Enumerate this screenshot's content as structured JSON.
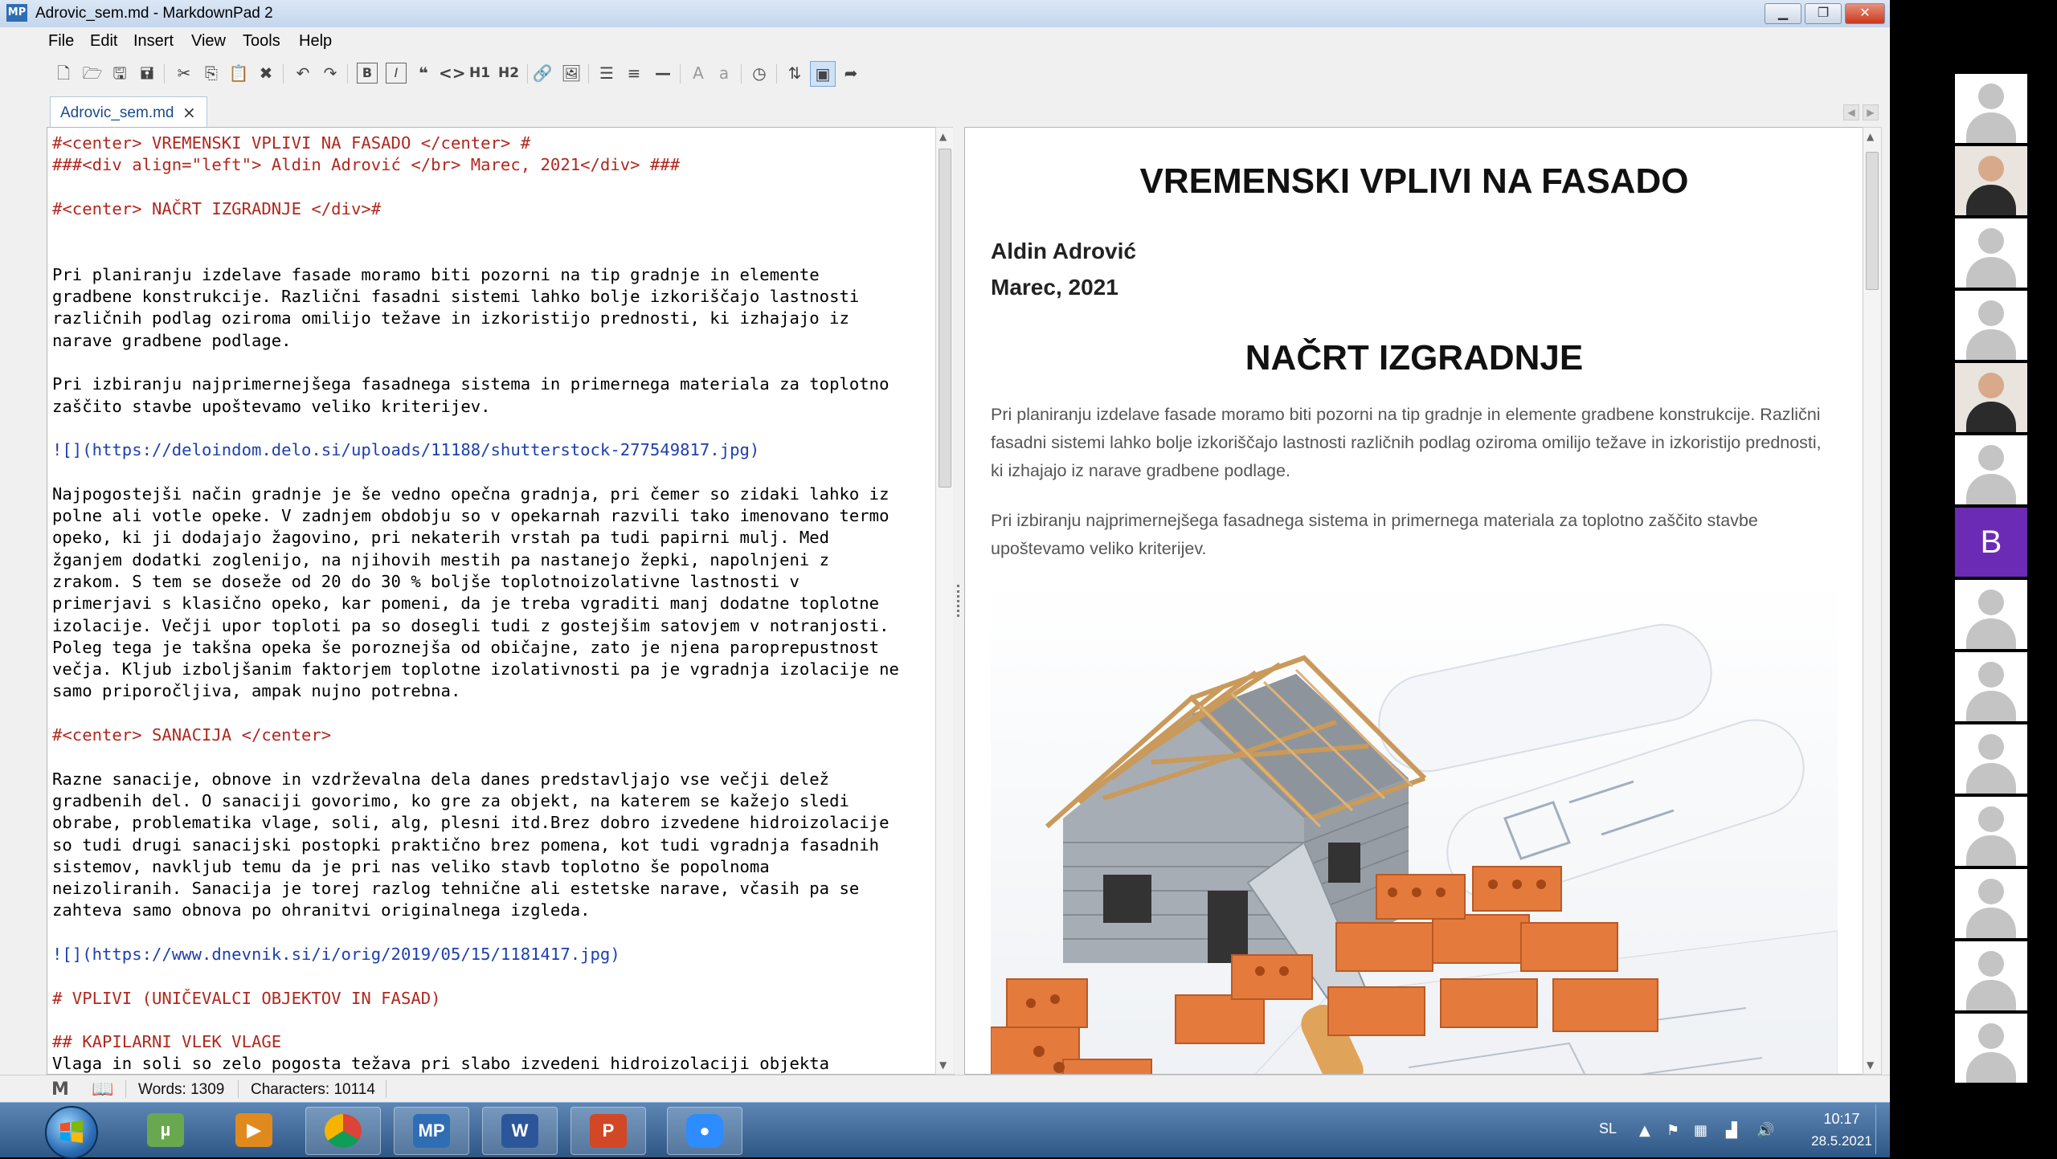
{
  "window": {
    "title": "Adrovic_sem.md - MarkdownPad 2",
    "logo": "MP",
    "minimize_icon": "minimize-icon",
    "maximize_icon": "restore-icon",
    "close_icon": "close-icon"
  },
  "menu": [
    "File",
    "Edit",
    "Insert",
    "View",
    "Tools",
    "Help"
  ],
  "toolbar": {
    "icons": [
      "new-file-icon",
      "open-folder-icon",
      "save-icon",
      "save-all-icon",
      "cut-icon",
      "copy-icon",
      "paste-icon",
      "delete-icon",
      "undo-icon",
      "redo-icon",
      "bold-icon",
      "italic-icon",
      "quote-icon",
      "code-icon",
      "h1-icon",
      "h2-icon",
      "link-icon",
      "image-icon",
      "bullet-list-icon",
      "numbered-list-icon",
      "horizontal-rule-icon",
      "uppercase-icon",
      "lowercase-icon",
      "timestamp-icon",
      "sync-scroll-icon",
      "live-preview-icon",
      "export-icon"
    ],
    "h1_label": "H1",
    "h2_label": "H2",
    "bold_label": "B",
    "italic_label": "I",
    "upper_label": "A",
    "lower_label": "a"
  },
  "tab": {
    "label": "Adrovic_sem.md",
    "close": "×"
  },
  "editor": {
    "lines": [
      {
        "text": "#<center> VREMENSKI VPLIVI NA FASADO </center> #",
        "kind": "hd"
      },
      {
        "text": "###<div align=\"left\"> Aldin Adrović </br> Marec, 2021</div> ###",
        "kind": "hd"
      },
      {
        "text": "",
        "kind": ""
      },
      {
        "text": "#<center> NAČRT IZGRADNJE </div>#",
        "kind": "hd"
      },
      {
        "text": "",
        "kind": ""
      },
      {
        "text": "",
        "kind": ""
      },
      {
        "text": "Pri planiranju izdelave fasade moramo biti pozorni na tip gradnje in elemente",
        "kind": ""
      },
      {
        "text": "gradbene konstrukcije. Različni fasadni sistemi lahko bolje izkoriščajo lastnosti",
        "kind": ""
      },
      {
        "text": "različnih podlag oziroma omilijo težave in izkoristijo prednosti, ki izhajajo iz",
        "kind": ""
      },
      {
        "text": "narave gradbene podlage.",
        "kind": ""
      },
      {
        "text": "",
        "kind": ""
      },
      {
        "text": "Pri izbiranju najprimernejšega fasadnega sistema in primernega materiala za toplotno",
        "kind": ""
      },
      {
        "text": "zaščito stavbe upoštevamo veliko kriterijev.",
        "kind": ""
      },
      {
        "text": "",
        "kind": ""
      },
      {
        "text": "![](https://deloindom.delo.si/uploads/11188/shutterstock-277549817.jpg)",
        "kind": "lk"
      },
      {
        "text": "",
        "kind": ""
      },
      {
        "text": "Najpogostejši način gradnje je še vedno opečna gradnja, pri čemer so zidaki lahko iz",
        "kind": ""
      },
      {
        "text": "polne ali votle opeke. V zadnjem obdobju so v opekarnah razvili tako imenovano termo",
        "kind": ""
      },
      {
        "text": "opeko, ki ji dodajajo žagovino, pri nekaterih vrstah pa tudi papirni mulj. Med",
        "kind": ""
      },
      {
        "text": "žganjem dodatki zoglenijo, na njihovih mestih pa nastanejo žepki, napolnjeni z",
        "kind": ""
      },
      {
        "text": "zrakom. S tem se doseže od 20 do 30 % boljše toplotnoizolativne lastnosti v",
        "kind": ""
      },
      {
        "text": "primerjavi s klasično opeko, kar pomeni, da je treba vgraditi manj dodatne toplotne",
        "kind": ""
      },
      {
        "text": "izolacije. Večji upor toploti pa so dosegli tudi z gostejšim satovjem v notranjosti.",
        "kind": ""
      },
      {
        "text": "Poleg tega je takšna opeka še poroznejša od običajne, zato je njena paroprepustnost",
        "kind": ""
      },
      {
        "text": "večja. Kljub izboljšanim faktorjem toplotne izolativnosti pa je vgradnja izolacije ne",
        "kind": ""
      },
      {
        "text": "samo priporočljiva, ampak nujno potrebna.",
        "kind": ""
      },
      {
        "text": "",
        "kind": ""
      },
      {
        "text": "#<center> SANACIJA </center>",
        "kind": "hd"
      },
      {
        "text": "",
        "kind": ""
      },
      {
        "text": "Razne sanacije, obnove in vzdrževalna dela danes predstavljajo vse večji delež",
        "kind": ""
      },
      {
        "text": "gradbenih del. O sanaciji govorimo, ko gre za objekt, na katerem se kažejo sledi",
        "kind": ""
      },
      {
        "text": "obrabe, problematika vlage, soli, alg, plesni itd.Brez dobro izvedene hidroizolacije",
        "kind": ""
      },
      {
        "text": "so tudi drugi sanacijski postopki praktično brez pomena, kot tudi vgradnja fasadnih",
        "kind": ""
      },
      {
        "text": "sistemov, navkljub temu da je pri nas veliko stavb toplotno še popolnoma",
        "kind": ""
      },
      {
        "text": "neizoliranih. Sanacija je torej razlog tehnične ali estetske narave, včasih pa se",
        "kind": ""
      },
      {
        "text": "zahteva samo obnova po ohranitvi originalnega izgleda.",
        "kind": ""
      },
      {
        "text": "",
        "kind": ""
      },
      {
        "text": "![](https://www.dnevnik.si/i/orig/2019/05/15/1181417.jpg)",
        "kind": "lk"
      },
      {
        "text": "",
        "kind": ""
      },
      {
        "text": "# VPLIVI (UNIČEVALCI OBJEKTOV IN FASAD)",
        "kind": "hd"
      },
      {
        "text": "",
        "kind": ""
      },
      {
        "text": "## KAPILARNI VLEK VLAGE",
        "kind": "hd"
      },
      {
        "text": "Vlaga in soli so zelo pogosta težava pri slabo izvedeni hidroizolaciji objekta",
        "kind": ""
      }
    ]
  },
  "preview": {
    "title": "VREMENSKI VPLIVI NA FASADO",
    "author": "Aldin Adrović",
    "date": "Marec, 2021",
    "heading": "NAČRT IZGRADNJE",
    "paragraph1": "Pri planiranju izdelave fasade moramo biti pozorni na tip gradnje in elemente gradbene konstrukcije. Različni fasadni sistemi lahko bolje izkoriščajo lastnosti različnih podlag oziroma omilijo težave in izkoristijo prednosti, ki izhajajo iz narave gradbene podlage.",
    "paragraph2": "Pri izbiranju najprimernejšega fasadnega sistema in primernega materiala za toplotno zaščito stavbe upoštevamo veliko kriterijev.",
    "image_icon": "house-construction-image"
  },
  "status": {
    "words": "Words: 1309",
    "characters": "Characters: 10114",
    "markdown_icon": "markdown-icon",
    "book_icon": "book-icon"
  },
  "taskbar": {
    "apps": [
      {
        "name": "utorrent",
        "label": "µ",
        "color": "#6aa84f"
      },
      {
        "name": "media-player",
        "label": "▶",
        "color": "#e08a1e"
      },
      {
        "name": "chrome",
        "label": "",
        "color": "#db4437"
      },
      {
        "name": "markdownpad",
        "label": "MP",
        "color": "#2f6db4"
      },
      {
        "name": "word",
        "label": "W",
        "color": "#2b579a"
      },
      {
        "name": "powerpoint",
        "label": "P",
        "color": "#d24726"
      },
      {
        "name": "zoom",
        "label": "●",
        "color": "#2d8cff"
      }
    ],
    "language": "SL",
    "time": "10:17",
    "date": "28.5.2021"
  },
  "video_panel": {
    "tiles": [
      {
        "type": "avatar"
      },
      {
        "type": "video"
      },
      {
        "type": "avatar"
      },
      {
        "type": "avatar"
      },
      {
        "type": "video"
      },
      {
        "type": "avatar"
      },
      {
        "type": "letter",
        "letter": "B"
      },
      {
        "type": "avatar"
      },
      {
        "type": "avatar"
      },
      {
        "type": "avatar"
      },
      {
        "type": "avatar"
      },
      {
        "type": "avatar"
      },
      {
        "type": "avatar"
      },
      {
        "type": "avatar"
      }
    ]
  },
  "colors": {
    "heading_markup": "#b0281f",
    "link_markup": "#1d3fae",
    "letter_tile": "#6c2bb4"
  }
}
